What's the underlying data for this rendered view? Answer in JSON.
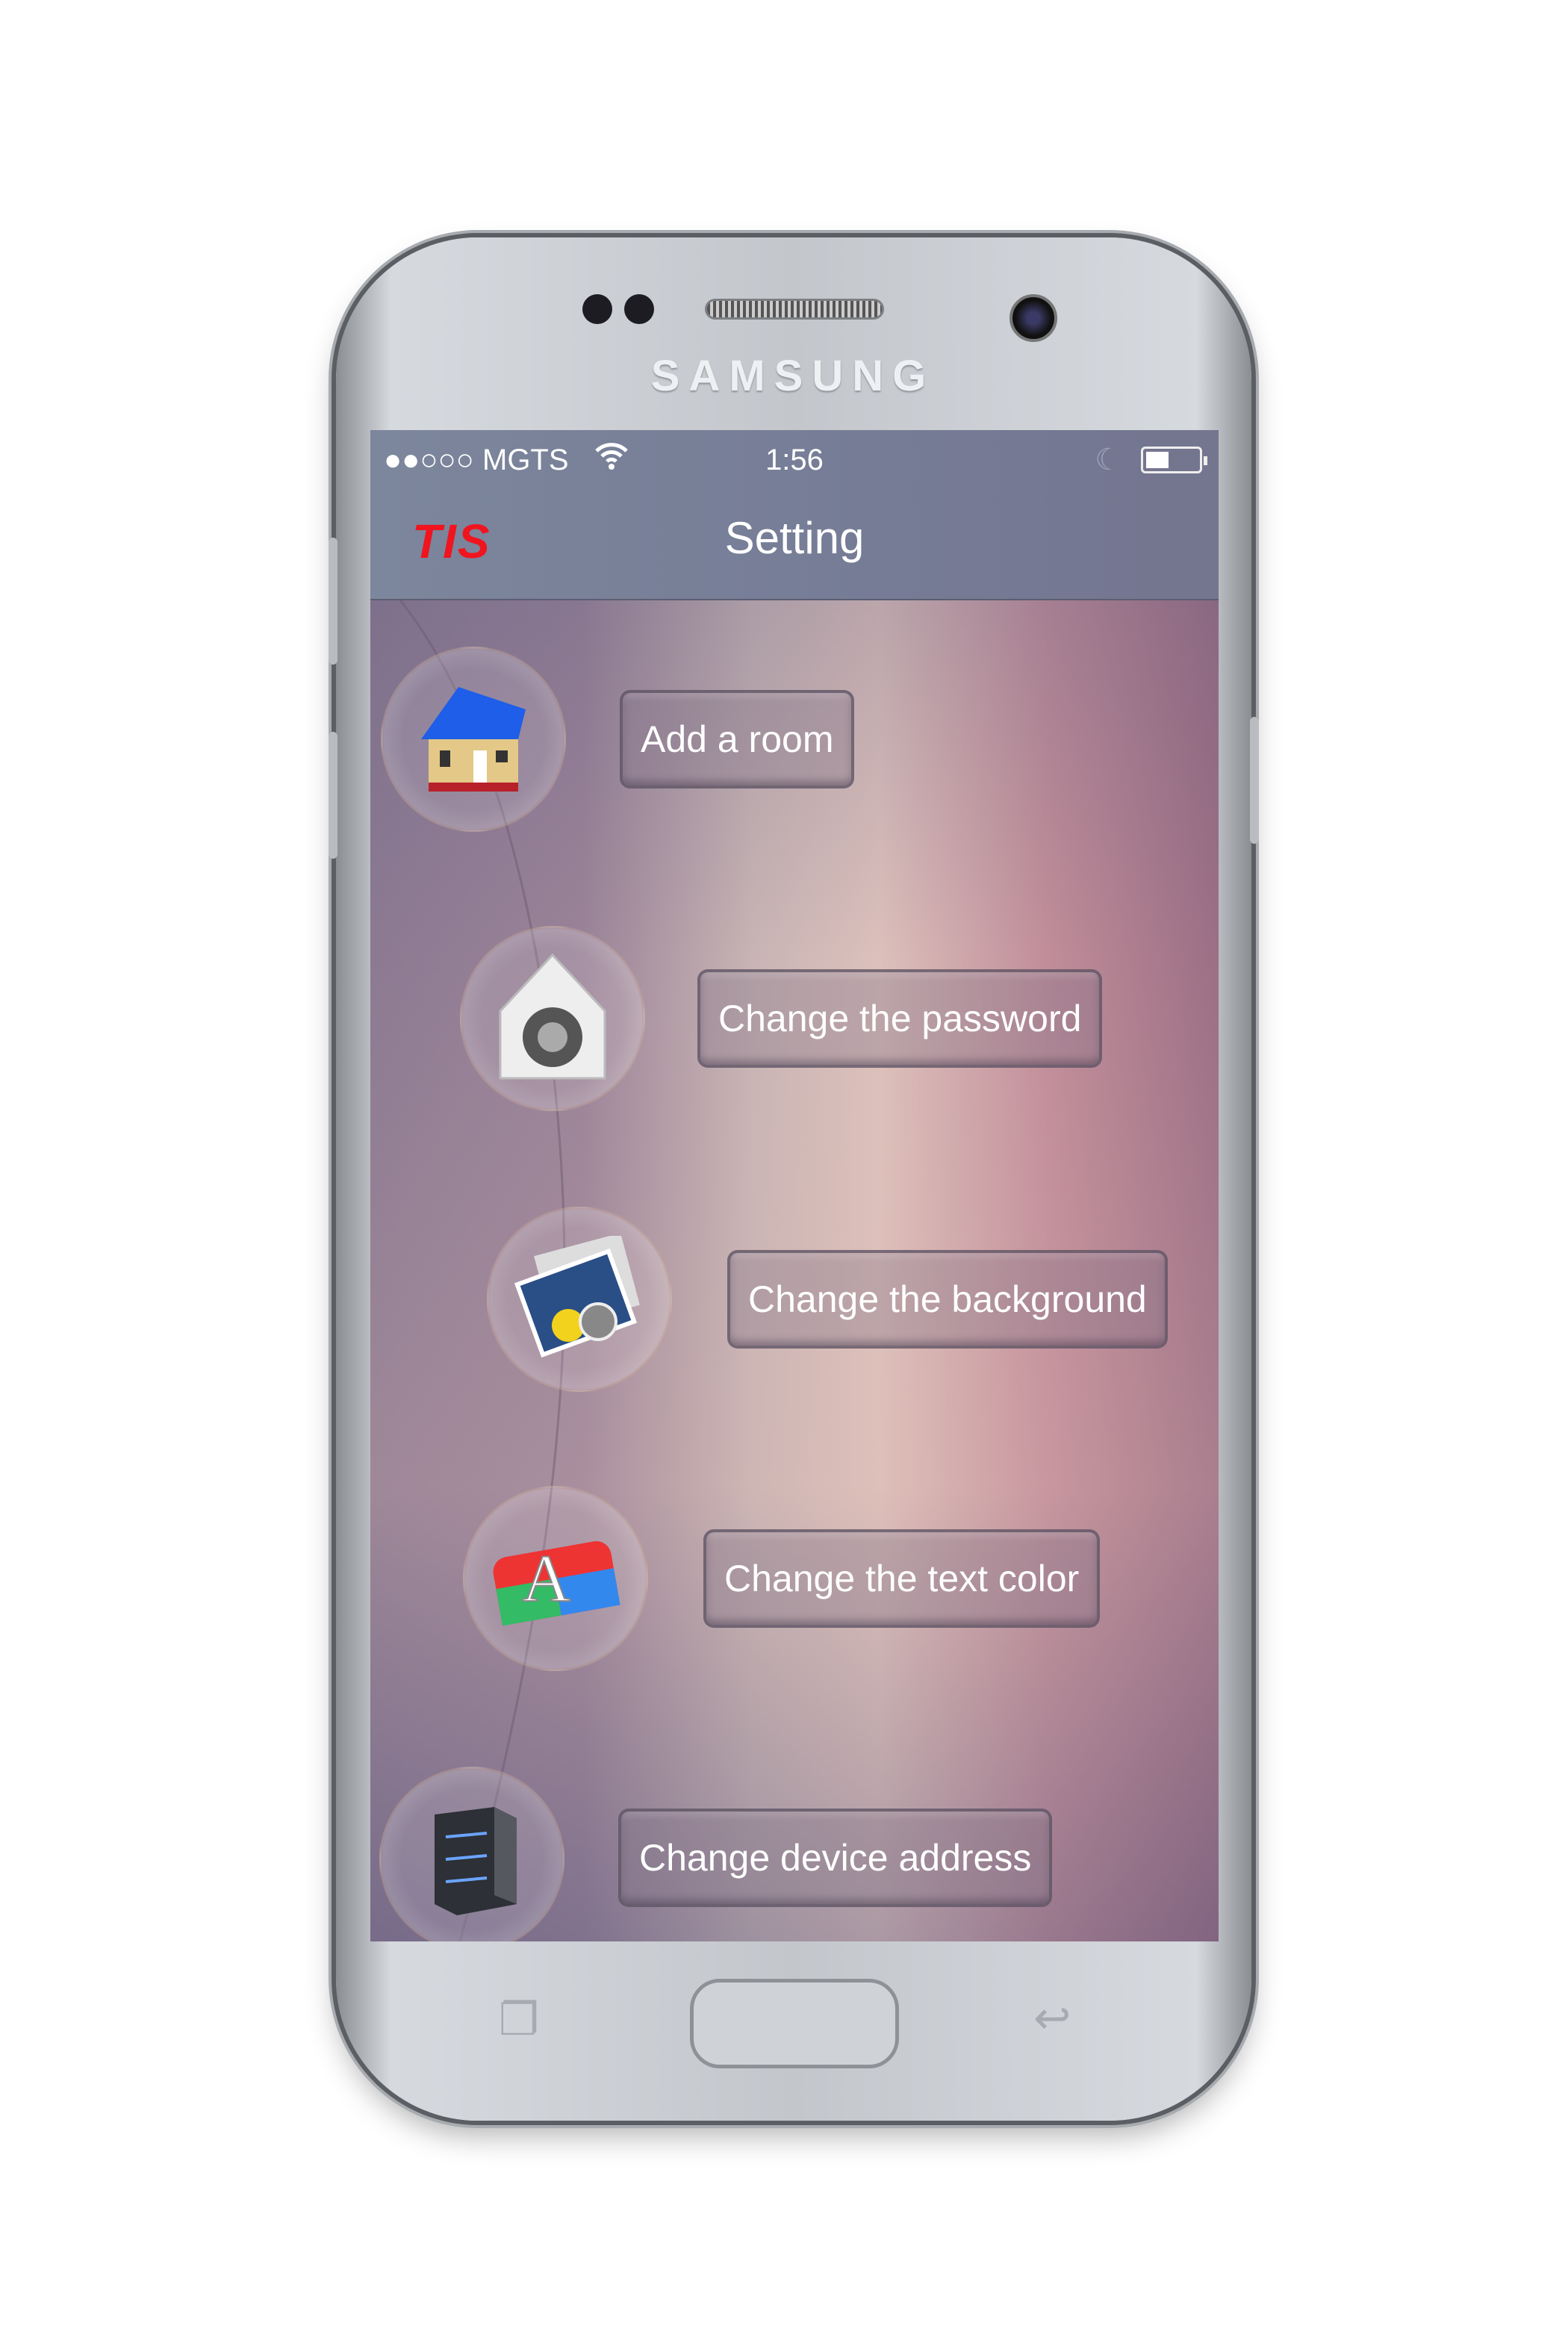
{
  "device": {
    "brand": "SAMSUNG"
  },
  "status_bar": {
    "signal": "●●○○○",
    "carrier": "MGTS",
    "time": "1:56"
  },
  "header": {
    "logo": "TIS",
    "title": "Setting"
  },
  "colors": {
    "logo": "#f0141e",
    "topbar": "#787f98",
    "button_text": "#ffffff"
  },
  "menu": [
    {
      "label": "Add a room",
      "icon": "house-icon"
    },
    {
      "label": "Change the password",
      "icon": "safe-lock-icon"
    },
    {
      "label": "Change the background",
      "icon": "photos-icon"
    },
    {
      "label": "Change the text color",
      "icon": "font-color-icon"
    },
    {
      "label": "Change device address",
      "icon": "server-icon"
    }
  ]
}
